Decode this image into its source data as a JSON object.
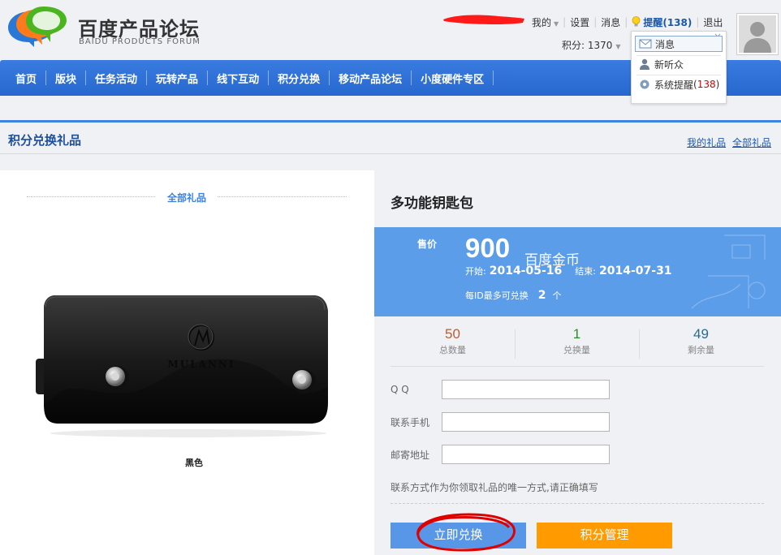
{
  "header": {
    "logo_title": "百度产品论坛",
    "logo_subtitle": "BAIDU PRODUCTS FORUM",
    "links": {
      "mine": "我的",
      "settings": "设置",
      "messages": "消息",
      "remind": "提醒(138)",
      "logout": "退出"
    },
    "points": "积分: 1370"
  },
  "notification_menu": {
    "items": [
      {
        "label": "消息",
        "icon": "envelope-icon"
      },
      {
        "label": "新听众",
        "icon": "user-icon"
      },
      {
        "label": "系统提醒",
        "count": "138",
        "icon": "gear-icon"
      }
    ]
  },
  "nav": {
    "items": [
      "首页",
      "版块",
      "任务活动",
      "玩转产品",
      "线下互动",
      "积分兑换",
      "移动产品论坛",
      "小度硬件专区"
    ]
  },
  "titlebar": {
    "title": "积分兑换礼品",
    "my_gifts": "我的礼品",
    "all_gifts": "全部礼品"
  },
  "left": {
    "section_label": "全部礼品",
    "image_brand": "MULANNI",
    "image_color": "黑色"
  },
  "product": {
    "name": "多功能钥匙包",
    "price_label": "售价",
    "price": "900",
    "currency": "百度金币",
    "start_label": "开始:",
    "start_date": "2014-05-16",
    "end_label": "结束:",
    "end_date": "2014-07-31",
    "limit_label": "每ID最多可兑换",
    "limit_value": "2",
    "limit_unit": "个"
  },
  "stats": [
    {
      "value": "50",
      "label": "总数量",
      "color": "#b45f3c"
    },
    {
      "value": "1",
      "label": "兑换量",
      "color": "#2e8b2e"
    },
    {
      "value": "49",
      "label": "剩余量",
      "color": "#2c6a8a"
    }
  ],
  "form": {
    "qq_label": "Q Q",
    "qq_value": "",
    "phone_label": "联系手机",
    "phone_value": "",
    "address_label": "邮寄地址",
    "address_value": "",
    "note": "联系方式作为你领取礼品的唯一方式,请正确填写"
  },
  "buttons": {
    "redeem": "立即兑换",
    "points": "积分管理"
  },
  "colors": {
    "nav": "#2f72d8",
    "price_box": "#5c9dea",
    "redeem": "#5897e8",
    "points_btn": "#ff9a00",
    "annotation": "#e00000"
  }
}
